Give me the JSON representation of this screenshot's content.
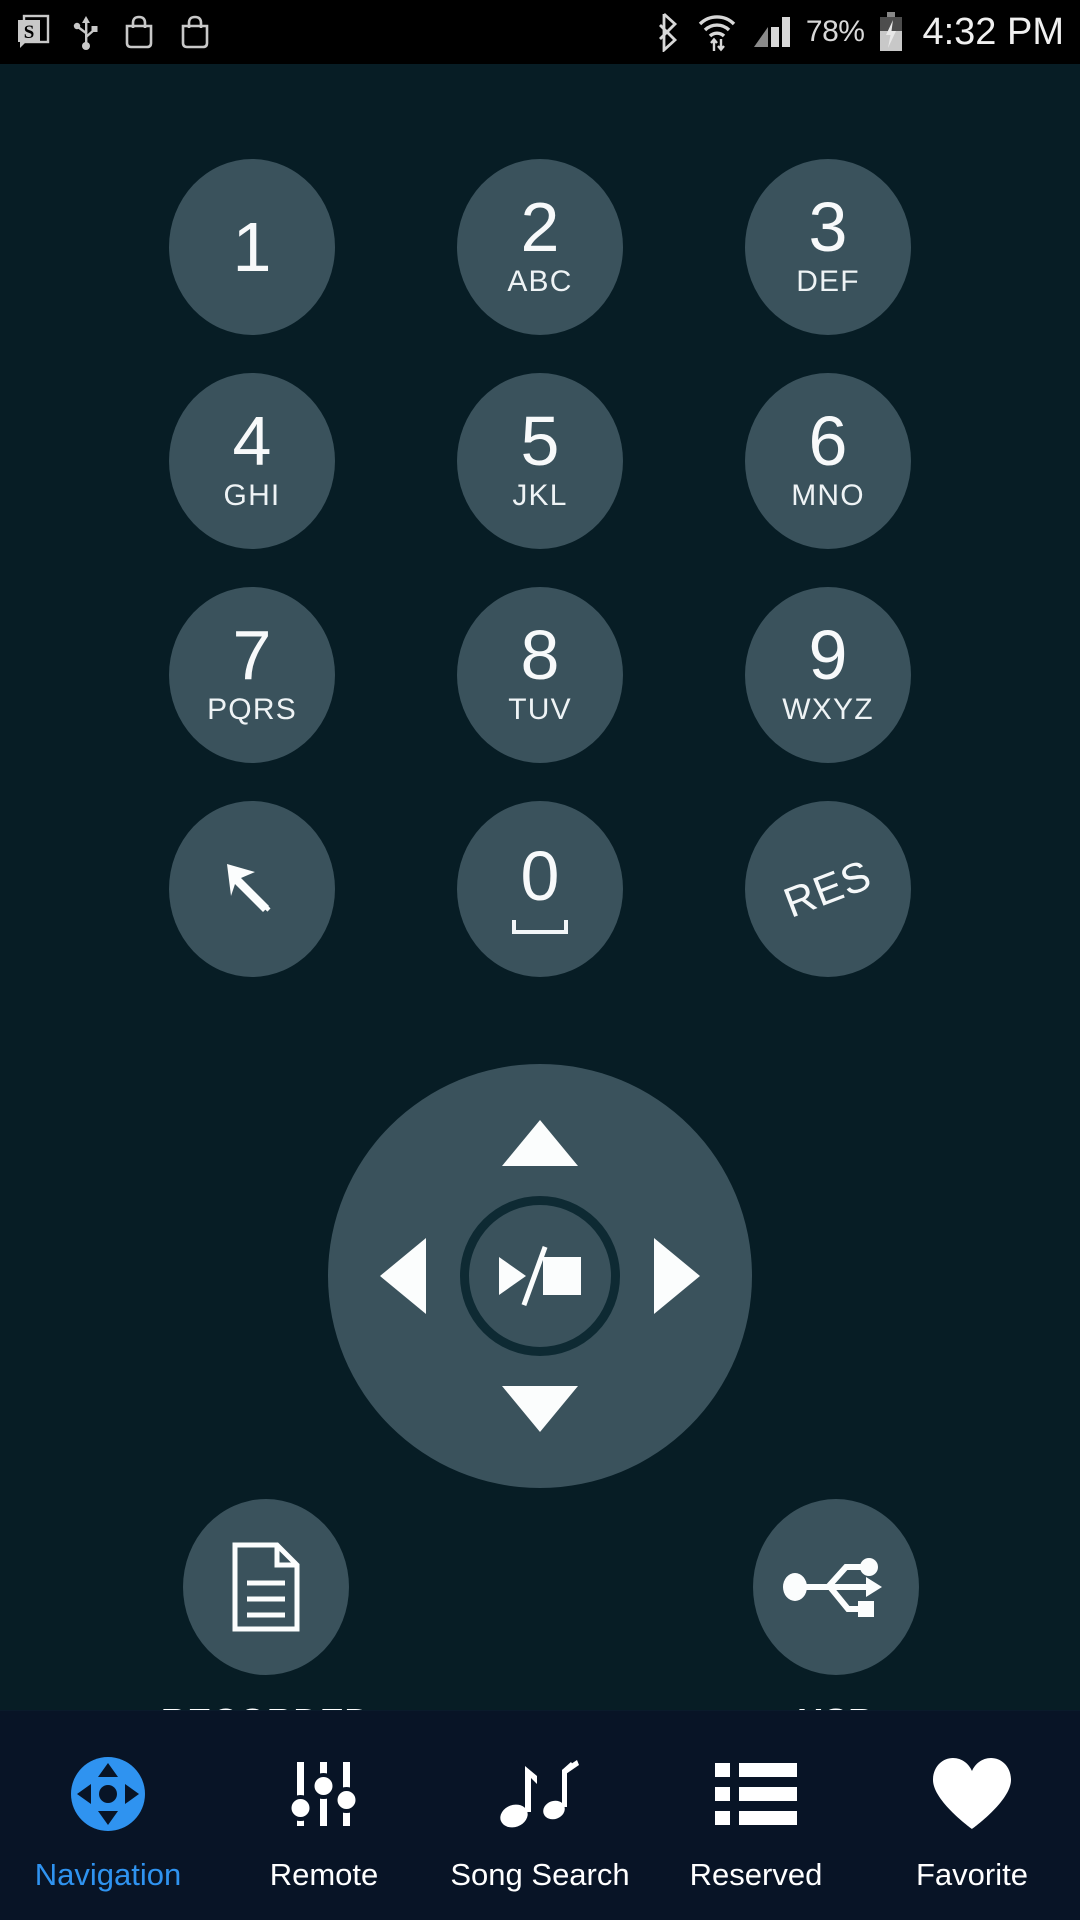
{
  "statusbar": {
    "icons_left": [
      "app-notification-icon",
      "usb-icon",
      "shopping-bag-icon",
      "shopping-bag-icon"
    ],
    "icons_right": [
      "bluetooth-icon",
      "wifi-icon",
      "cellular-signal-icon"
    ],
    "battery_percent": "78%",
    "battery_state": "charging",
    "clock": "4:32 PM"
  },
  "theme": {
    "background": "#071d25",
    "key_fill": "#3a525c",
    "key_text": "#f7f9fa",
    "navbar_bg": "#081426",
    "accent": "#2f93f0",
    "statusbar_bg": "#000000"
  },
  "keypad": {
    "rows": [
      [
        {
          "digit": "1",
          "letters": "",
          "icon": ""
        },
        {
          "digit": "2",
          "letters": "ABC",
          "icon": ""
        },
        {
          "digit": "3",
          "letters": "DEF",
          "icon": ""
        }
      ],
      [
        {
          "digit": "4",
          "letters": "GHI",
          "icon": ""
        },
        {
          "digit": "5",
          "letters": "JKL",
          "icon": ""
        },
        {
          "digit": "6",
          "letters": "MNO",
          "icon": ""
        }
      ],
      [
        {
          "digit": "7",
          "letters": "PQRS",
          "icon": ""
        },
        {
          "digit": "8",
          "letters": "TUV",
          "icon": ""
        },
        {
          "digit": "9",
          "letters": "WXYZ",
          "icon": ""
        }
      ],
      [
        {
          "digit": "",
          "letters": "",
          "icon": "back-arrow-icon"
        },
        {
          "digit": "0",
          "letters": "",
          "icon": "space-bar-icon"
        },
        {
          "digit": "",
          "letters": "RES",
          "icon": "res-label"
        }
      ]
    ]
  },
  "dpad": {
    "up_icon": "arrow-up-icon",
    "down_icon": "arrow-down-icon",
    "left_icon": "arrow-left-icon",
    "right_icon": "arrow-right-icon",
    "center_icon": "play-stop-icon"
  },
  "action_buttons": [
    {
      "label": "RECORDED",
      "icon": "document-icon"
    },
    {
      "label": "USB",
      "icon": "usb-icon"
    }
  ],
  "navbar": {
    "items": [
      {
        "label": "Navigation",
        "icon": "dpad-circle-icon",
        "active": true
      },
      {
        "label": "Remote",
        "icon": "sliders-icon",
        "active": false
      },
      {
        "label": "Song Search",
        "icon": "music-notes-icon",
        "active": false
      },
      {
        "label": "Reserved",
        "icon": "list-icon",
        "active": false
      },
      {
        "label": "Favorite",
        "icon": "heart-icon",
        "active": false
      }
    ]
  }
}
